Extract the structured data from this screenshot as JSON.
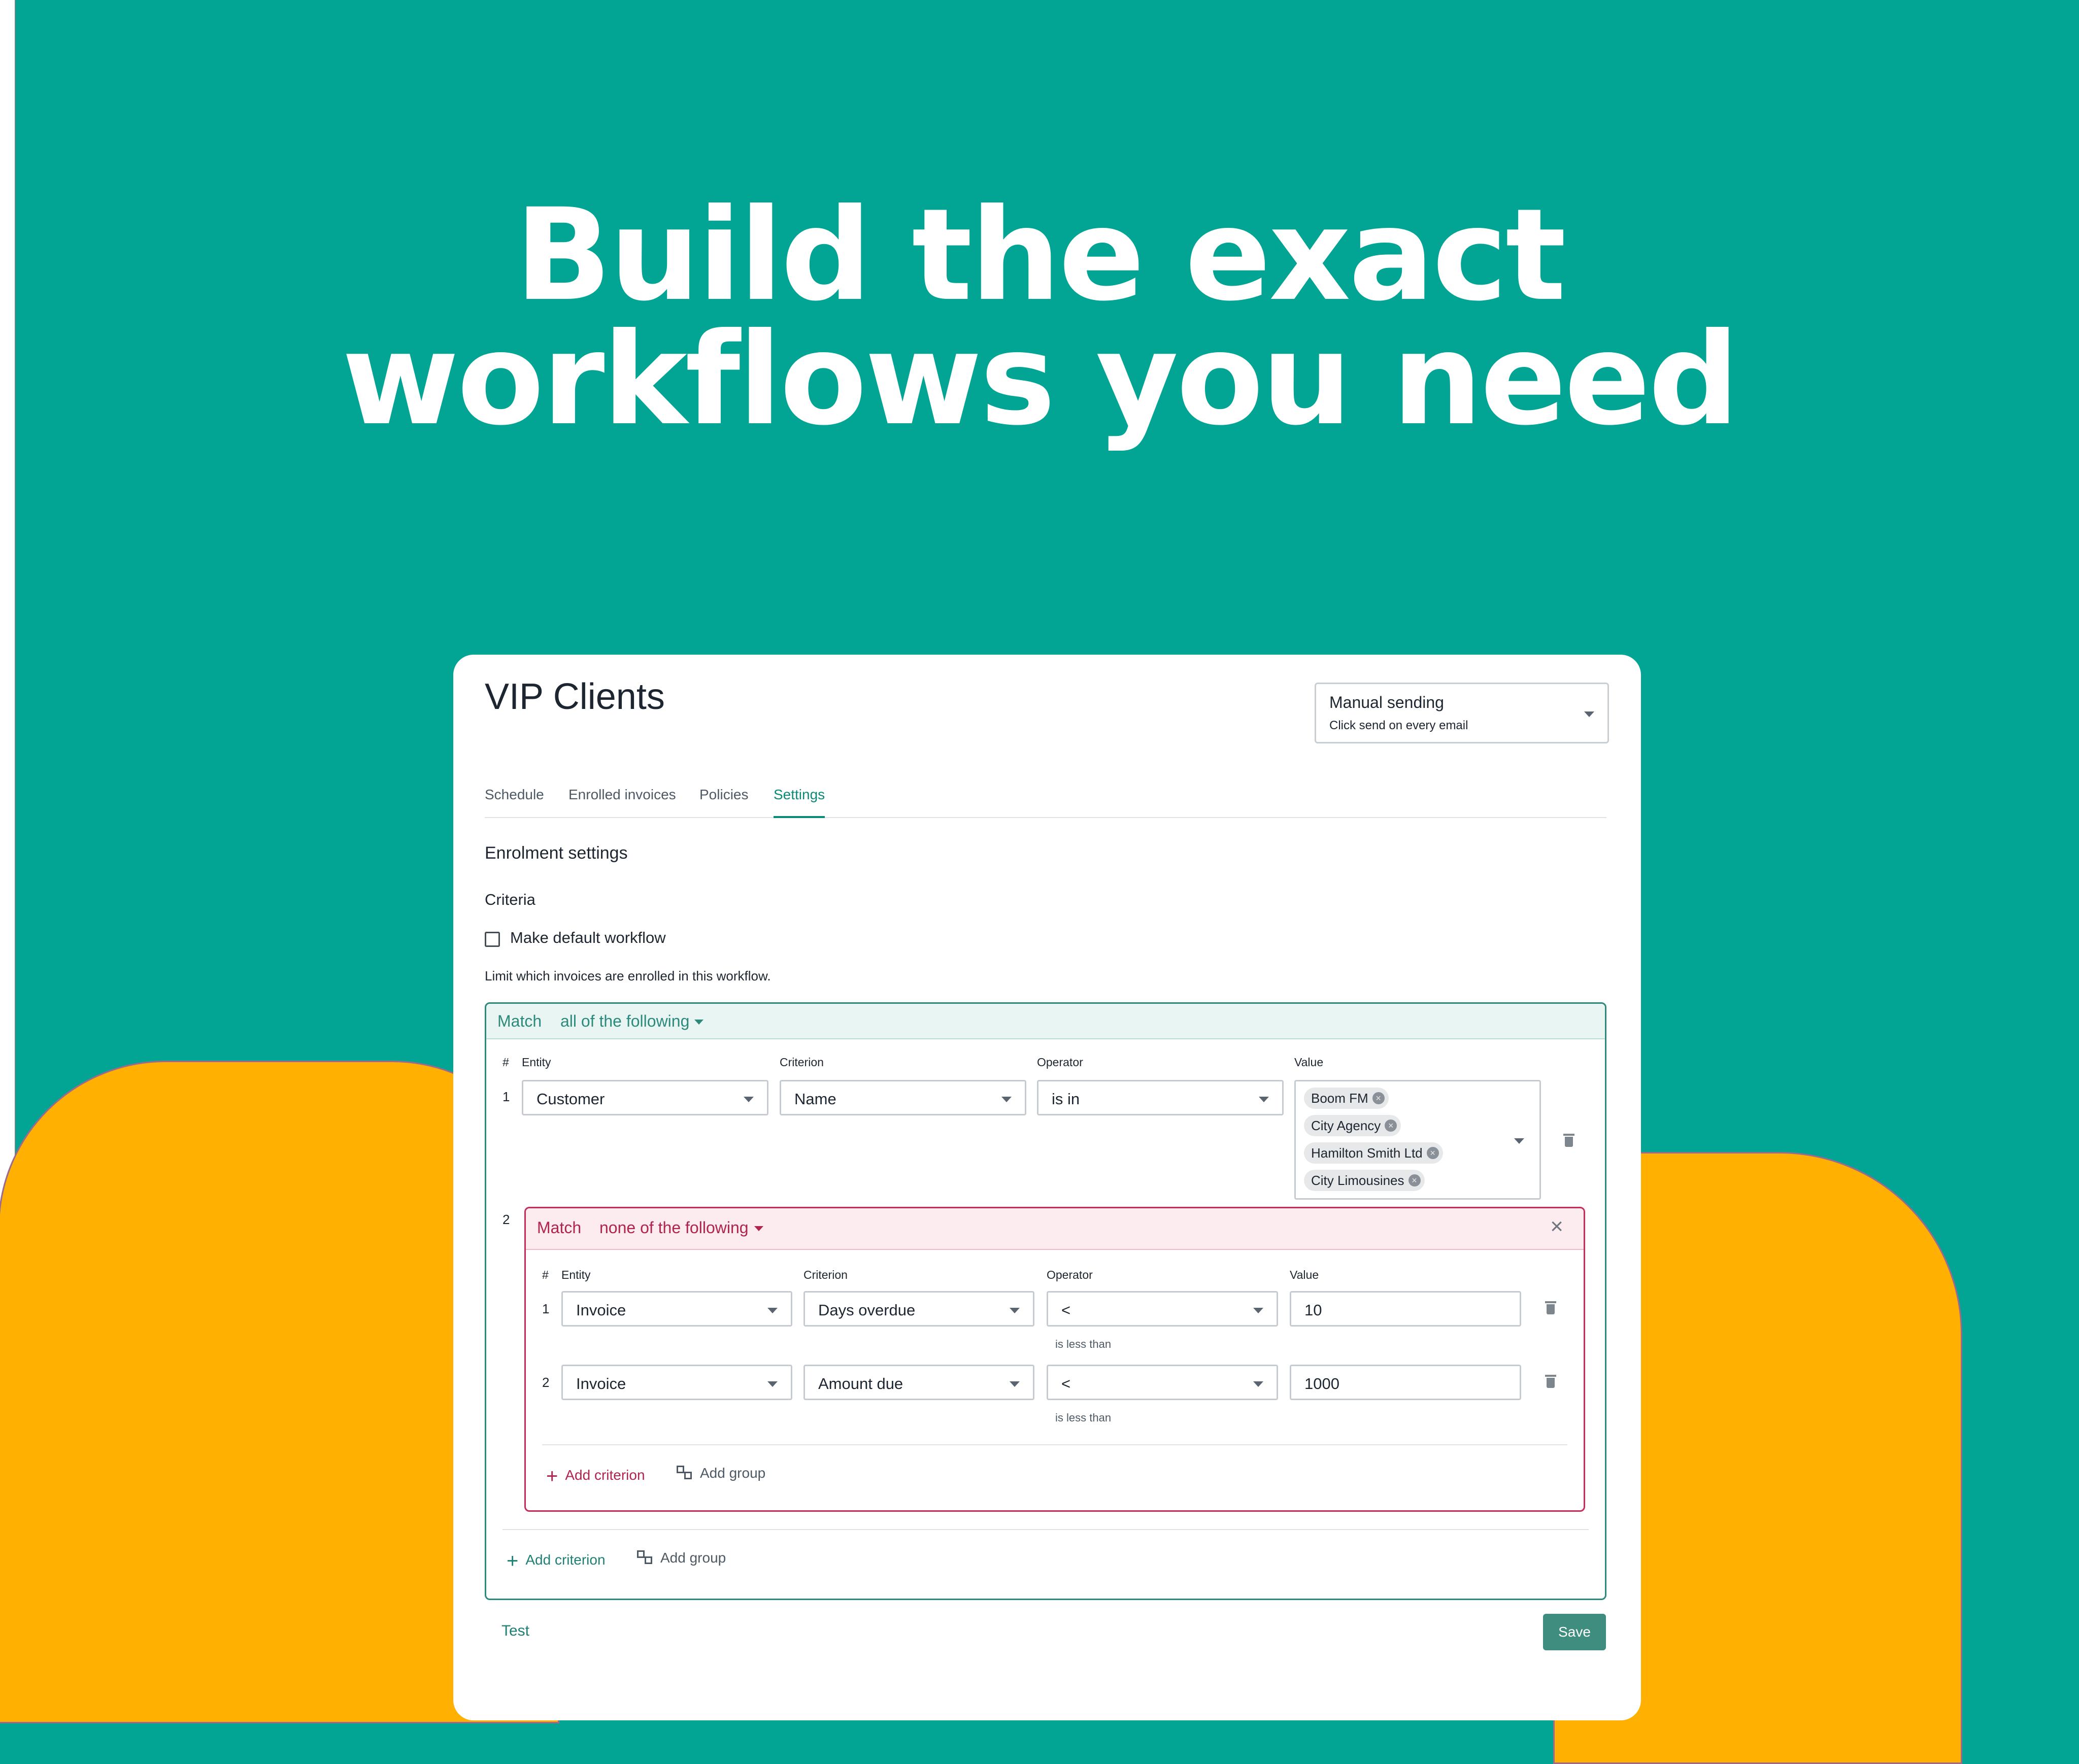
{
  "hero": {
    "line1": "Build the exact",
    "line2": "workflows you need"
  },
  "workflow": {
    "title": "VIP Clients",
    "sending": {
      "main": "Manual sending",
      "sub": "Click send on every email"
    },
    "tabs": [
      "Schedule",
      "Enrolled invoices",
      "Policies",
      "Settings"
    ],
    "active_tab": "Settings",
    "section_title": "Enrolment settings",
    "criteria_title": "Criteria",
    "default_checkbox": {
      "label": "Make default workflow",
      "checked": false
    },
    "limit_text": "Limit which invoices are enrolled in this workflow.",
    "outer_group": {
      "match_label": "Match",
      "match_mode": "all of the following",
      "columns": [
        "#",
        "Entity",
        "Criterion",
        "Operator",
        "Value"
      ],
      "row1": {
        "num": "1",
        "entity": "Customer",
        "criterion": "Name",
        "operator": "is in",
        "values": [
          "Boom FM",
          "City Agency",
          "Hamilton Smith Ltd",
          "City Limousines"
        ]
      },
      "row2_num": "2",
      "inner_group": {
        "match_label": "Match",
        "match_mode": "none of the following",
        "columns": [
          "#",
          "Entity",
          "Criterion",
          "Operator",
          "Value"
        ],
        "rows": [
          {
            "num": "1",
            "entity": "Invoice",
            "criterion": "Days overdue",
            "operator": "<",
            "operator_hint": "is less than",
            "value": "10"
          },
          {
            "num": "2",
            "entity": "Invoice",
            "criterion": "Amount due",
            "operator": "<",
            "operator_hint": "is less than",
            "value": "1000"
          }
        ],
        "add_criterion": "Add criterion",
        "add_group": "Add group"
      },
      "add_criterion": "Add criterion",
      "add_group": "Add group"
    },
    "test_label": "Test",
    "save_label": "Save"
  },
  "colors": {
    "background": "#02a594",
    "blob": "#ffb000",
    "accent_green": "#2b8a7c",
    "accent_red": "#c82c5a"
  }
}
